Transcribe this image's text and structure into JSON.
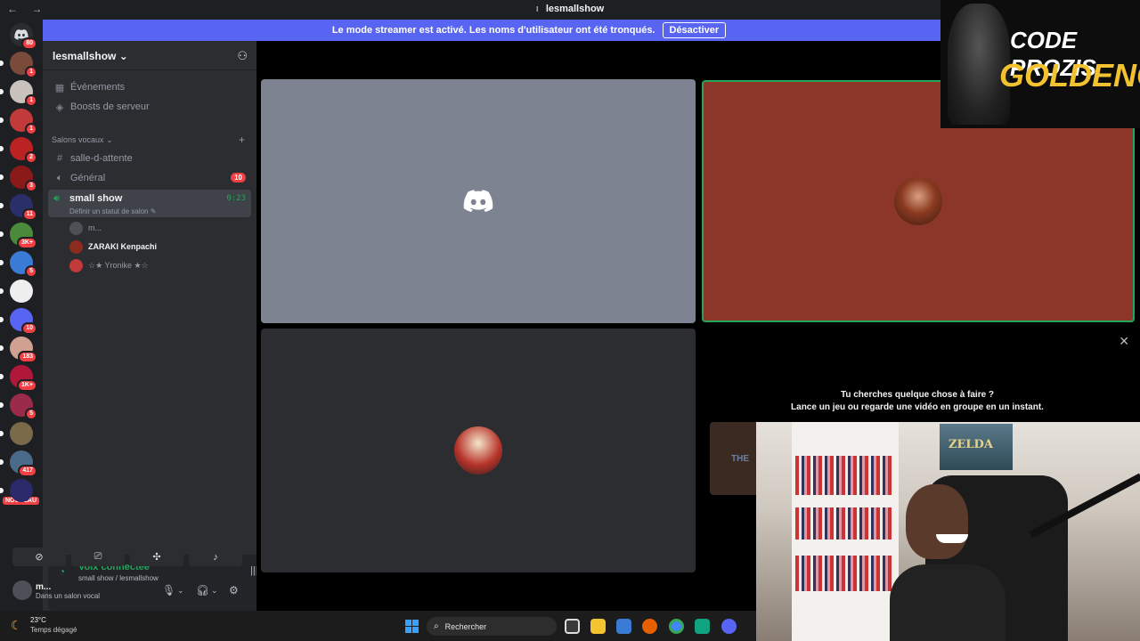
{
  "window": {
    "title": "lesmallshow",
    "nav": "← →",
    "controls": "▭ ? ⬇ ‒ ▢ ✕"
  },
  "banner": {
    "message": "Le mode streamer est activé. Les noms d'utilisateur ont été tronqués.",
    "button": "Désactiver"
  },
  "rail": {
    "home_badge": "80",
    "servers": [
      {
        "badge": "1",
        "color": "#7a4a3a"
      },
      {
        "badge": "1",
        "color": "#c9c2bd"
      },
      {
        "badge": "1",
        "color": "#c23a3a"
      },
      {
        "badge": "2",
        "color": "#b22"
      },
      {
        "badge": "3",
        "color": "#8a1a1a"
      },
      {
        "badge": "11",
        "color": "#2a2f6a"
      },
      {
        "badge": "3K+",
        "color": "#4a8a3a"
      },
      {
        "badge": "5",
        "color": "#3a7bd5"
      },
      {
        "badge": "",
        "color": "#eee"
      },
      {
        "badge": "10",
        "color": "#5865f2"
      },
      {
        "badge": "183",
        "color": "#d0a090"
      },
      {
        "badge": "1K+",
        "color": "#b0183a"
      },
      {
        "badge": "5",
        "color": "#9a2a4a"
      },
      {
        "badge": "",
        "color": "#7a6a4a"
      },
      {
        "badge": "417",
        "color": "#4a6a8a"
      },
      {
        "badge": "",
        "color": "#2a2a6a"
      }
    ],
    "new_label": "NOUVEAU"
  },
  "sidebar": {
    "server_name": "lesmallshow",
    "events": "Événements",
    "boosts": "Boosts de serveur",
    "category": "Salons vocaux",
    "channels": {
      "waiting": "salle-d-attente",
      "general": "Général",
      "general_badge": "10",
      "active": "small show",
      "active_time": "0:23",
      "active_status": "Définir un statut de salon"
    },
    "members": [
      {
        "name": "m...",
        "color": "#4e5058"
      },
      {
        "name": "ZARAKI Kenpachi",
        "color": "#8b2c1e"
      },
      {
        "name": "☆★ Yronike ★☆",
        "color": "#c23a3a"
      }
    ]
  },
  "voice": {
    "status": "Voix connectée",
    "location": "small show / lesmallshow"
  },
  "user": {
    "name": "m...",
    "status": "Dans un salon vocal"
  },
  "stage": {
    "tiles": [
      {
        "bg": "#7d8390"
      },
      {
        "bg": "#8b3629",
        "border": "#23a55a"
      },
      {
        "bg": "#2b2d31"
      }
    ]
  },
  "activity": {
    "line1": "Tu cherches quelque chose à faire ?",
    "line2": "Lance un jeu ou regarde une vidéo en groupe en un instant.",
    "thumb_text": "THE"
  },
  "webcam": {
    "poster_text": "ZELDA"
  },
  "logo": {
    "line1": "CODE PROZIS",
    "line2": "GOLDENG"
  },
  "taskbar": {
    "temperature": "23°C",
    "condition": "Temps dégagé",
    "search": "Rechercher"
  }
}
